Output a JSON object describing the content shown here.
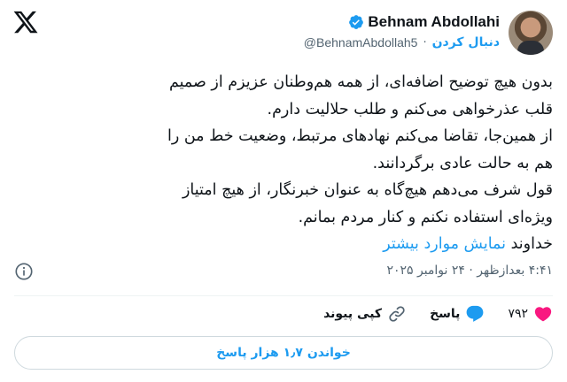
{
  "header": {
    "name": "Behnam Abdollahi",
    "handle": "@BehnamAbdollah5",
    "follow_label": "دنبال کردن",
    "separator": "·"
  },
  "tweet": {
    "lines": [
      "بدون هیچ توضیح اضافه‌ای، از همه هم‌وطنان عزیزم از صمیم",
      "قلب عذرخواهی می‌کنم و طلب حلالیت دارم.",
      "از همین‌جا، تقاضا می‌کنم نهادهای مرتبط، وضعیت خط من را",
      "هم به حالت عادی برگردانند.",
      "قول شرف می‌دهم هیچ‌گاه به عنوان خبرنگار، از هیچ امتیاز",
      "ویژه‌ای استفاده نکنم و کنار مردم بمانم."
    ],
    "last_line_prefix": "خداوند ",
    "show_more": "نمایش موارد بیشتر"
  },
  "meta": {
    "time": "۴:۴۱ بعدازظهر",
    "separator": "·",
    "date": "۲۴ نوامبر ۲۰۲۵"
  },
  "actions": {
    "likes": "۷۹۲",
    "reply_label": "پاسخ",
    "copy_link_label": "کپی پیوند"
  },
  "replies_button": "خواندن ۱٫۷ هزار پاسخ",
  "colors": {
    "accent": "#1d9bf0",
    "like": "#f91880",
    "muted": "#536471",
    "text": "#0f1419"
  },
  "icons": [
    "x-logo-icon",
    "verified-badge-icon",
    "info-icon",
    "heart-icon",
    "reply-icon",
    "link-icon"
  ]
}
